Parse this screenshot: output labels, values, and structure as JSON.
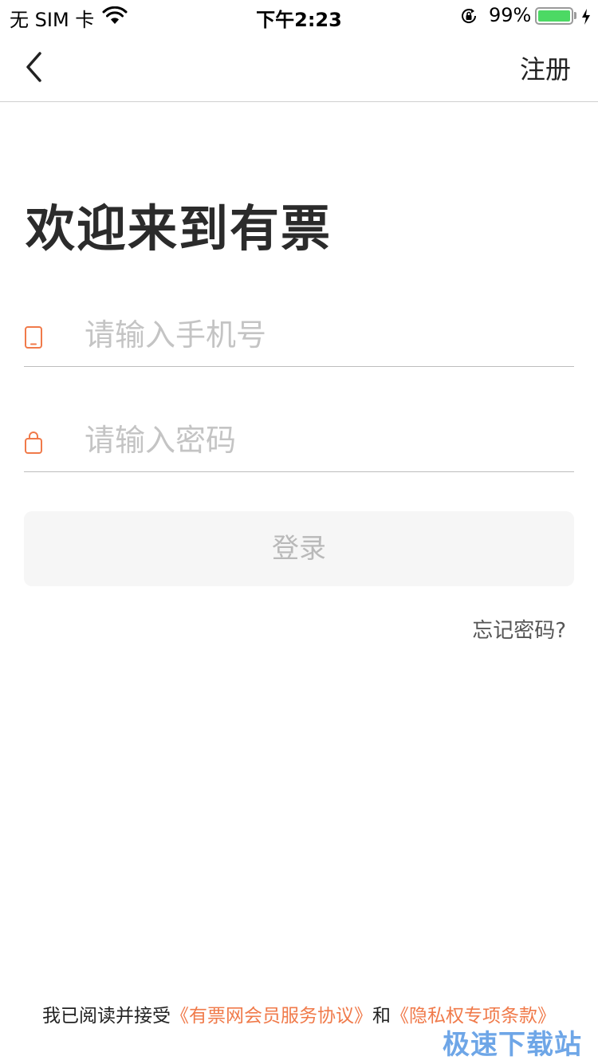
{
  "status_bar": {
    "carrier": "无 SIM 卡",
    "time": "下午2:23",
    "battery_percent": "99%",
    "battery_level": 0.99,
    "icons": [
      "wifi-icon",
      "orientation-lock-icon",
      "battery-icon",
      "charging-bolt-icon"
    ]
  },
  "nav": {
    "back_icon": "chevron-left-icon",
    "register_label": "注册"
  },
  "welcome_title": "欢迎来到有票",
  "form": {
    "phone": {
      "icon": "phone-icon",
      "placeholder": "请输入手机号",
      "value": ""
    },
    "password": {
      "icon": "lock-icon",
      "placeholder": "请输入密码",
      "value": ""
    },
    "login_label": "登录",
    "forgot_label": "忘记密码?"
  },
  "agreement": {
    "prefix": "我已阅读并接受",
    "link1": "《有票网会员服务协议》",
    "middle": "和",
    "link2": "《隐私权专项条款》"
  },
  "watermark": "极速下载站",
  "colors": {
    "accent": "#f07a4a",
    "button_bg": "#f6f6f6",
    "button_text": "#b9b9b9",
    "placeholder": "#c4c4c4",
    "battery": "#4cd964"
  }
}
